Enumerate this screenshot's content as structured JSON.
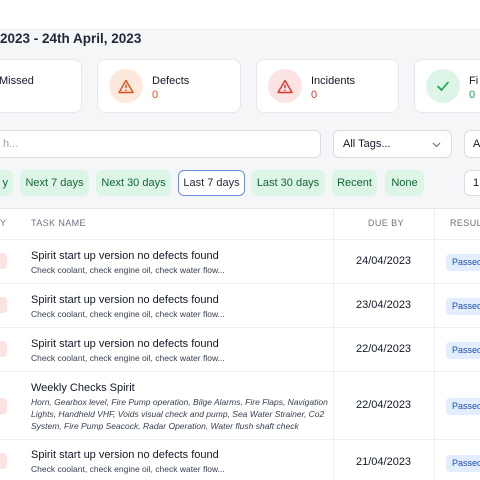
{
  "header": {
    "date_range": "2023 - 24th April, 2023"
  },
  "stats": [
    {
      "label": "Missed",
      "value": ""
    },
    {
      "label": "Defects",
      "value": "0"
    },
    {
      "label": "Incidents",
      "value": "0"
    },
    {
      "label": "Fi",
      "value": "0"
    }
  ],
  "colors": {
    "defects": "#e04f1a",
    "incidents": "#e0352b",
    "fixed": "#16a34a",
    "chip_bg": "#dcf5e7",
    "chip_text": "#166534",
    "active_border": "#6b8de8",
    "badge_bg": "#e2edff"
  },
  "filters": {
    "search_placeholder": "h...",
    "tags_label": "All Tags...",
    "extra_select": "A",
    "page_size": "1"
  },
  "chips": [
    "y",
    "Next 7 days",
    "Next 30 days",
    "Last 7 days",
    "Last 30 days",
    "Recent",
    "None"
  ],
  "active_chip": "Last 7 days",
  "table": {
    "headers": {
      "priority": "Y",
      "task": "TASK NAME",
      "due": "DUE BY",
      "result": "RESULT"
    },
    "rows": [
      {
        "title": "Spirit start up version no defects found",
        "sub": "Check coolant, check engine oil, check water flow...",
        "due": "24/04/2023",
        "result": "Passed"
      },
      {
        "title": "Spirit start up version no defects found",
        "sub": "Check coolant, check engine oil, check water flow...",
        "due": "23/04/2023",
        "result": "Passed"
      },
      {
        "title": "Spirit start up version no defects found",
        "sub": "Check coolant, check engine oil, check water flow...",
        "due": "22/04/2023",
        "result": "Passed"
      },
      {
        "title": "Weekly Checks Spirit",
        "sub": "Horn, Gearbox level, Fire Pump operation, Bilge Alarms, Fire Flaps, Navigation Lights, Handheld VHF, Voids visual check and pump, Sea Water Strainer, Co2 System, Fire Pump Seacock, Radar Operation, Water flush shaft check",
        "due": "22/04/2023",
        "result": "Passed"
      },
      {
        "title": "Spirit start up version no defects found",
        "sub": "Check coolant, check engine oil, check water flow...",
        "due": "21/04/2023",
        "result": "Passed"
      }
    ]
  }
}
